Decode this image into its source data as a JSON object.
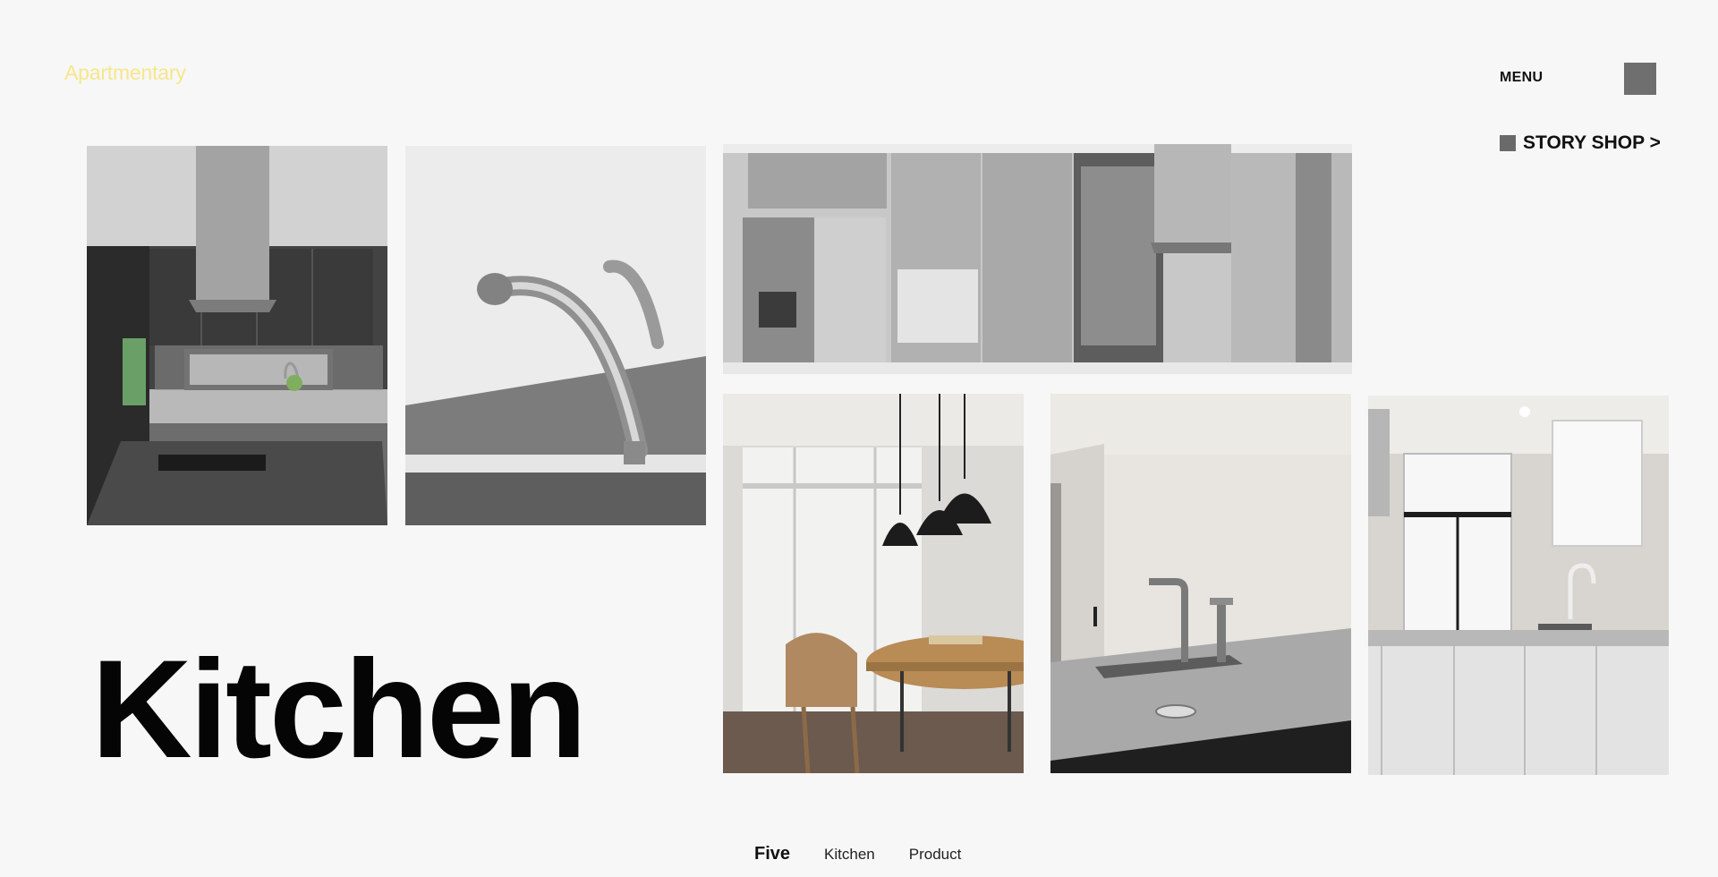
{
  "brand": {
    "name": "Apartmentary"
  },
  "header": {
    "menu_label": "MENU",
    "story_shop_label": "STORY SHOP >"
  },
  "page": {
    "title": "Kitchen"
  },
  "bottom_nav": {
    "items": [
      {
        "label": "Five",
        "active": true
      },
      {
        "label": "Kitchen",
        "active": false
      },
      {
        "label": "Product",
        "active": false
      }
    ]
  },
  "gallery": {
    "images": [
      {
        "name": "kitchen-island-hood-photo"
      },
      {
        "name": "chrome-faucet-closeup-photo"
      },
      {
        "name": "refrigerator-cabinet-wall-photo"
      },
      {
        "name": "dining-pendant-lights-photo"
      },
      {
        "name": "sink-counter-photo"
      },
      {
        "name": "white-kitchen-cabinets-photo"
      }
    ]
  },
  "colors": {
    "background": "#f7f7f7",
    "logo": "#f6e68c",
    "accent_square": "#6f6f6f",
    "headline": "#050505"
  }
}
